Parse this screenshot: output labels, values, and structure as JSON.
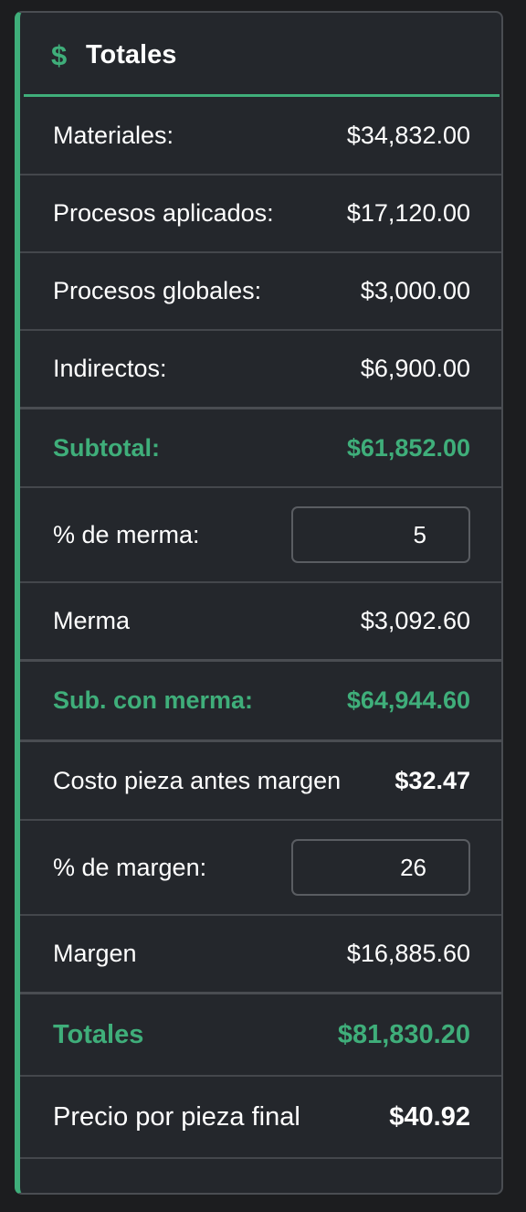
{
  "panel": {
    "icon": "dollar-icon",
    "icon_glyph": "$",
    "title": "Totales",
    "accent_color": "#3fae7a",
    "background_color": "#24272c"
  },
  "rows": {
    "materiales": {
      "label": "Materiales:",
      "value": "$34,832.00"
    },
    "procesos_aplicados": {
      "label": "Procesos aplicados:",
      "value": "$17,120.00"
    },
    "procesos_globales": {
      "label": "Procesos globales:",
      "value": "$3,000.00"
    },
    "indirectos": {
      "label": "Indirectos:",
      "value": "$6,900.00"
    },
    "subtotal": {
      "label": "Subtotal:",
      "value": "$61,852.00"
    },
    "pct_merma": {
      "label": "% de merma:",
      "value": "5"
    },
    "merma": {
      "label": "Merma",
      "value": "$3,092.60"
    },
    "sub_con_merma": {
      "label": "Sub. con merma:",
      "value": "$64,944.60"
    },
    "costo_pieza": {
      "label": "Costo pieza antes margen",
      "value": "$32.47"
    },
    "pct_margen": {
      "label": "% de margen:",
      "value": "26"
    },
    "margen": {
      "label": "Margen",
      "value": "$16,885.60"
    },
    "totales": {
      "label": "Totales",
      "value": "$81,830.20"
    },
    "precio_final": {
      "label": "Precio por pieza final",
      "value": "$40.92"
    }
  }
}
